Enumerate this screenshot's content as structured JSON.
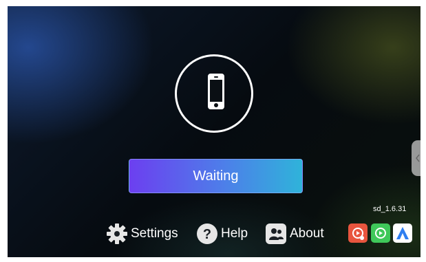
{
  "status": {
    "label": "Waiting"
  },
  "version": "sd_1.6.31",
  "bottom_menu": {
    "settings_label": "Settings",
    "help_label": "Help",
    "about_label": "About"
  },
  "icons": {
    "phone": "smartphone-icon",
    "settings": "gear-icon",
    "help": "question-mark-icon",
    "about": "people-icon",
    "carplay_red": "carplay-play-icon",
    "carplay_green": "carplay-play-icon",
    "android_auto": "android-auto-icon",
    "side_tab": "chevron-left-icon"
  },
  "colors": {
    "button_gradient_start": "#6c3ff0",
    "button_gradient_end": "#2fb3da",
    "carplay_red": "#e8553e",
    "carplay_green": "#3fc85a",
    "android_auto_blue": "#2f7ff0"
  }
}
